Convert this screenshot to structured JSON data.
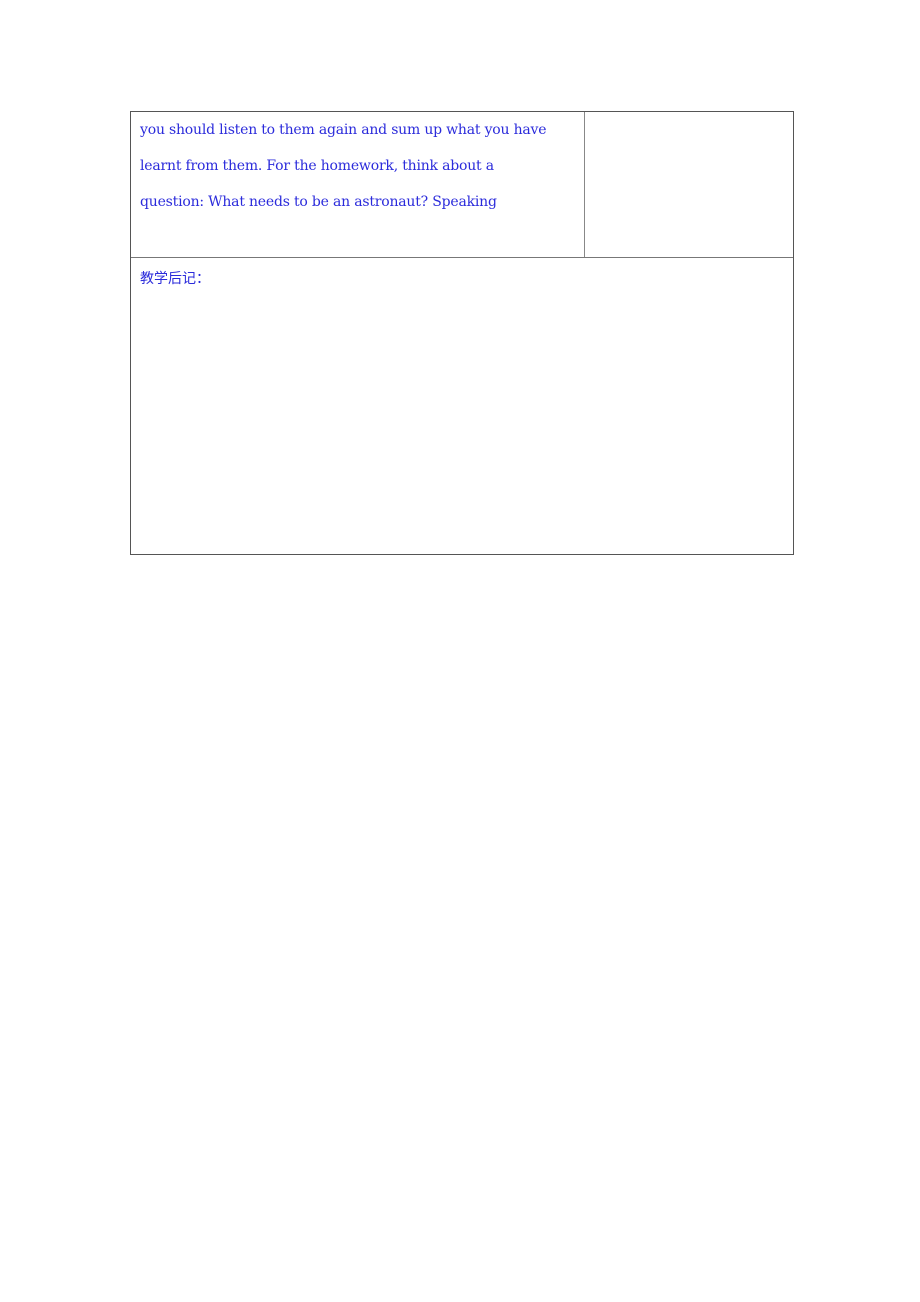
{
  "table": {
    "row1": {
      "left_cell_lines": [
        "you should listen to them again and sum up what you have",
        "learnt from them. For the homework, think about a",
        "question: What needs to be an astronaut? Speaking"
      ],
      "right_cell": ""
    },
    "row2": {
      "label": "教学后记："
    }
  },
  "colors": {
    "text": "#2b2bdb",
    "border": "#555555"
  }
}
